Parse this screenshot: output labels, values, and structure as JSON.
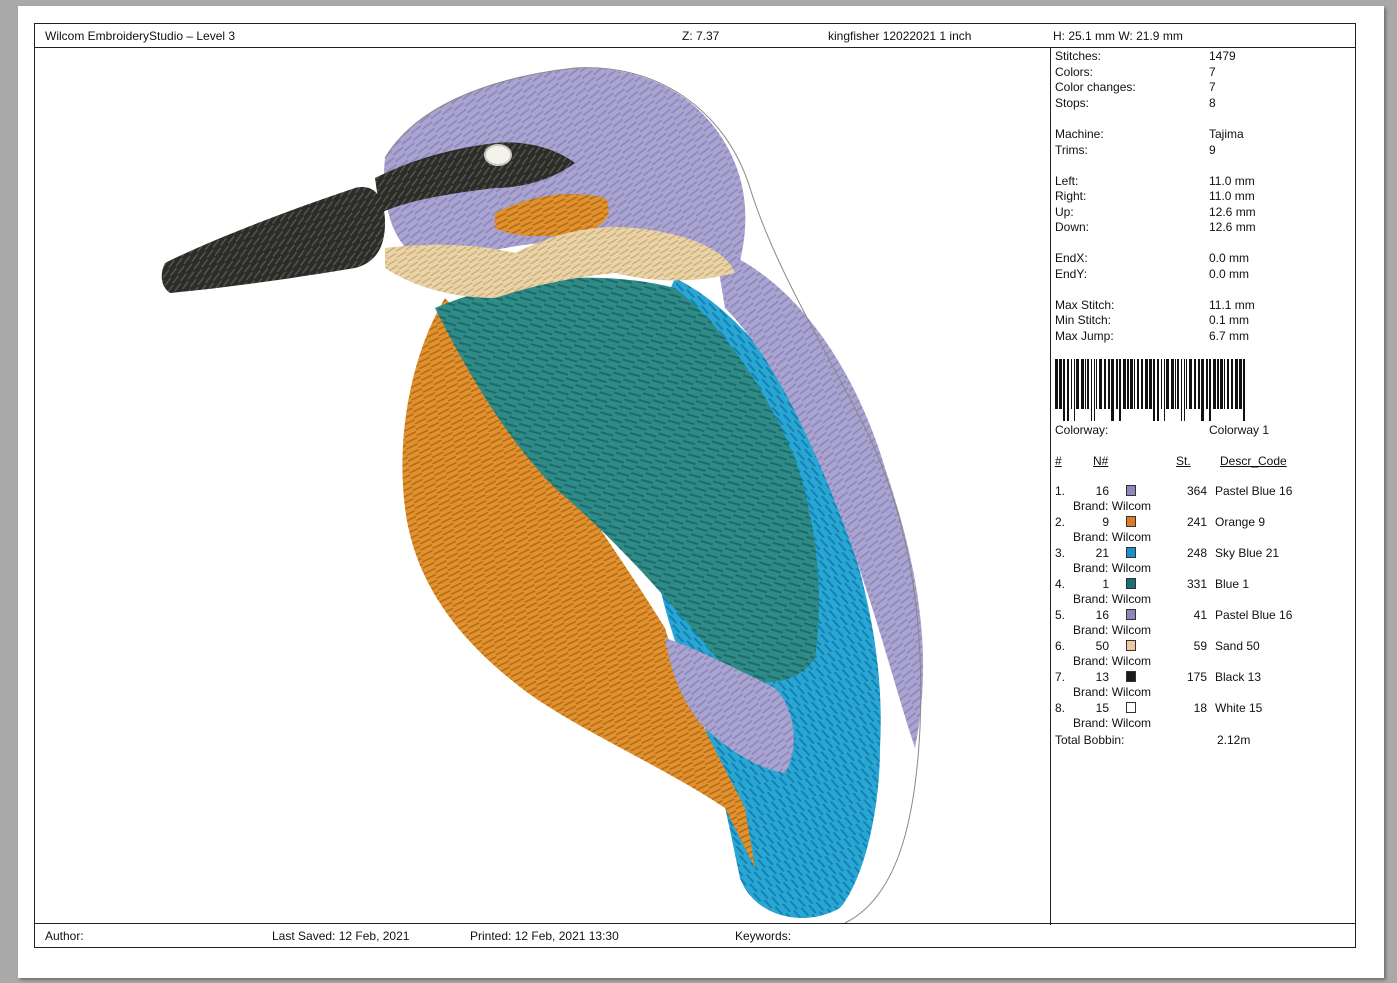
{
  "header": {
    "app_title": "Wilcom EmbroideryStudio – Level 3",
    "zoom": "Z: 7.37",
    "design_name": "kingfisher 12022021 1 inch",
    "size": "H: 25.1 mm   W: 21.9 mm"
  },
  "stats": [
    {
      "label": "Stitches:",
      "value": "1479"
    },
    {
      "label": "Colors:",
      "value": "7"
    },
    {
      "label": "Color changes:",
      "value": "7"
    },
    {
      "label": "Stops:",
      "value": "8"
    },
    {
      "label": "Machine:",
      "value": "Tajima"
    },
    {
      "label": "Trims:",
      "value": "9"
    },
    {
      "label": "Left:",
      "value": "11.0 mm"
    },
    {
      "label": "Right:",
      "value": "11.0 mm"
    },
    {
      "label": "Up:",
      "value": "12.6 mm"
    },
    {
      "label": "Down:",
      "value": "12.6 mm"
    },
    {
      "label": "EndX:",
      "value": "0.0 mm"
    },
    {
      "label": "EndY:",
      "value": "0.0 mm"
    },
    {
      "label": "Max Stitch:",
      "value": "11.1 mm"
    },
    {
      "label": "Min Stitch:",
      "value": "0.1 mm"
    },
    {
      "label": "Max Jump:",
      "value": "6.7 mm"
    }
  ],
  "colorway": {
    "label": "Colorway:",
    "value": "Colorway 1"
  },
  "table_headers": {
    "num": "#",
    "n": "N#",
    "st": "St.",
    "descr": "Descr_Code"
  },
  "threads": [
    {
      "idx": "1.",
      "n": "16",
      "color": "#8e87bd",
      "st": "364",
      "descr": "Pastel Blue 16",
      "brand": "Brand: Wilcom"
    },
    {
      "idx": "2.",
      "n": "9",
      "color": "#e07a20",
      "st": "241",
      "descr": "Orange 9",
      "brand": "Brand: Wilcom"
    },
    {
      "idx": "3.",
      "n": "21",
      "color": "#1a8fc8",
      "st": "248",
      "descr": "Sky Blue 21",
      "brand": "Brand: Wilcom"
    },
    {
      "idx": "4.",
      "n": "1",
      "color": "#1b6f72",
      "st": "331",
      "descr": "Blue 1",
      "brand": "Brand: Wilcom"
    },
    {
      "idx": "5.",
      "n": "16",
      "color": "#8e87bd",
      "st": "41",
      "descr": "Pastel Blue 16",
      "brand": "Brand: Wilcom"
    },
    {
      "idx": "6.",
      "n": "50",
      "color": "#f0c8a0",
      "st": "59",
      "descr": "Sand 50",
      "brand": "Brand: Wilcom"
    },
    {
      "idx": "7.",
      "n": "13",
      "color": "#1a1a1a",
      "st": "175",
      "descr": "Black 13",
      "brand": "Brand: Wilcom"
    },
    {
      "idx": "8.",
      "n": "15",
      "color": "#ffffff",
      "st": "18",
      "descr": "White 15",
      "brand": "Brand: Wilcom"
    }
  ],
  "bobbin": {
    "label": "Total Bobbin:",
    "value": "2.12m"
  },
  "footer": {
    "author": "Author:",
    "last_saved": "Last Saved: 12 Feb, 2021",
    "printed": "Printed: 12 Feb, 2021 13:30",
    "keywords": "Keywords:"
  },
  "design_colors": {
    "head": "#a9a4d0",
    "head_dark": "#8f89bd",
    "orange": "#e0922e",
    "orange_dark": "#b86a18",
    "teal": "#2f8b88",
    "teal_dark": "#1d6a69",
    "sky": "#2aa6d4",
    "sky_dark": "#137fae",
    "sand": "#ead3a6",
    "black": "#2b2b28",
    "white": "#f2f2ea"
  }
}
